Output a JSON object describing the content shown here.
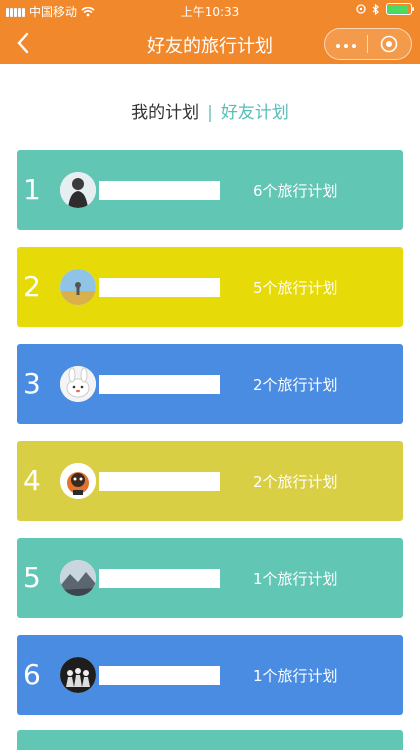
{
  "status": {
    "carrier": "中国移动",
    "time": "上午10:33"
  },
  "nav": {
    "title": "好友的旅行计划"
  },
  "tabs": {
    "mine": "我的计划",
    "separator": "|",
    "friends": "好友计划"
  },
  "colors": {
    "header": "#f1892c",
    "teal": "#62c6b4",
    "yellow": "#e6da09",
    "blue": "#4a8ce2",
    "olive": "#d9cf45"
  },
  "plans": [
    {
      "rank": "1",
      "count": "6个旅行计划",
      "color": "#62c6b4",
      "avatar": "person-avatar"
    },
    {
      "rank": "2",
      "count": "5个旅行计划",
      "color": "#e6da09",
      "avatar": "landscape-avatar"
    },
    {
      "rank": "3",
      "count": "2个旅行计划",
      "color": "#4a8ce2",
      "avatar": "rabbit-avatar"
    },
    {
      "rank": "4",
      "count": "2个旅行计划",
      "color": "#d9cf45",
      "avatar": "cartoon-avatar"
    },
    {
      "rank": "5",
      "count": "1个旅行计划",
      "color": "#62c6b4",
      "avatar": "mountain-avatar"
    },
    {
      "rank": "6",
      "count": "1个旅行计划",
      "color": "#4a8ce2",
      "avatar": "group-avatar"
    }
  ]
}
